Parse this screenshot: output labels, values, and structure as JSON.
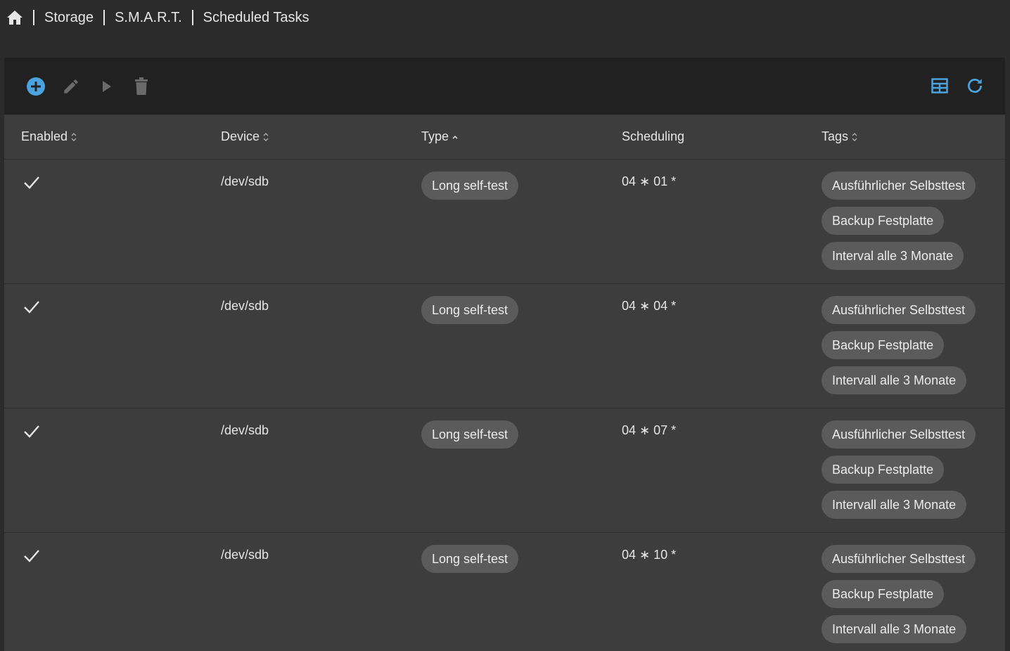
{
  "breadcrumb": {
    "items": [
      "Storage",
      "S.M.A.R.T.",
      "Scheduled Tasks"
    ]
  },
  "toolbar": {
    "left_icons": [
      "add-icon",
      "edit-icon",
      "run-icon",
      "delete-icon"
    ],
    "right_icons": [
      "columns-icon",
      "refresh-icon"
    ],
    "accent_color": "#4aa3df"
  },
  "table": {
    "columns": {
      "enabled": "Enabled",
      "device": "Device",
      "type": "Type",
      "scheduling": "Scheduling",
      "tags": "Tags"
    },
    "rows": [
      {
        "enabled": true,
        "device": "/dev/sdb",
        "type": "Long self-test",
        "scheduling": "04 ∗ 01 *",
        "tags": [
          "Ausführlicher Selbsttest",
          "Backup Festplatte",
          "Interval alle 3 Monate"
        ]
      },
      {
        "enabled": true,
        "device": "/dev/sdb",
        "type": "Long self-test",
        "scheduling": "04 ∗ 04 *",
        "tags": [
          "Ausführlicher Selbsttest",
          "Backup Festplatte",
          "Intervall alle 3 Monate"
        ]
      },
      {
        "enabled": true,
        "device": "/dev/sdb",
        "type": "Long self-test",
        "scheduling": "04 ∗ 07 *",
        "tags": [
          "Ausführlicher Selbsttest",
          "Backup Festplatte",
          "Intervall alle 3 Monate"
        ]
      },
      {
        "enabled": true,
        "device": "/dev/sdb",
        "type": "Long self-test",
        "scheduling": "04 ∗ 10 *",
        "tags": [
          "Ausführlicher Selbsttest",
          "Backup Festplatte",
          "Intervall alle 3 Monate"
        ]
      }
    ]
  }
}
